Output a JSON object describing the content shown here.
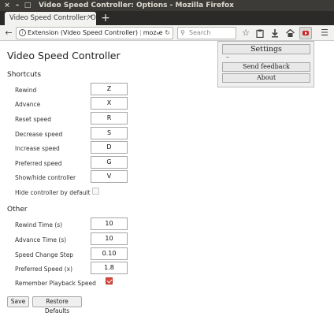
{
  "window": {
    "title": "Video Speed Controller: Options - Mozilla Firefox",
    "close_glyph": "×",
    "min_glyph": "–",
    "max_glyph": "□"
  },
  "tabs": [
    {
      "label": "Video Speed Controller: O",
      "close": "×"
    }
  ],
  "newtab_glyph": "+",
  "navbar": {
    "url_identity": "Extension (Video Speed Controller)",
    "url_text": "moz-e",
    "search_placeholder": "Search"
  },
  "page": {
    "title": "Video Speed Controller",
    "shortcuts_heading": "Shortcuts",
    "shortcuts": [
      {
        "label": "Rewind",
        "key": "Z"
      },
      {
        "label": "Advance",
        "key": "X"
      },
      {
        "label": "Reset speed",
        "key": "R"
      },
      {
        "label": "Decrease speed",
        "key": "S"
      },
      {
        "label": "Increase speed",
        "key": "D"
      },
      {
        "label": "Preferred speed",
        "key": "G"
      },
      {
        "label": "Show/hide controller",
        "key": "V"
      }
    ],
    "hide_controller_label": "Hide controller by default",
    "hide_controller_checked": false,
    "other_heading": "Other",
    "other": [
      {
        "label": "Rewind Time (s)",
        "value": "10"
      },
      {
        "label": "Advance Time (s)",
        "value": "10"
      },
      {
        "label": "Speed Change Step",
        "value": "0.10"
      },
      {
        "label": "Preferred Speed (x)",
        "value": "1.8"
      }
    ],
    "remember_label": "Remember Playback Speed",
    "remember_checked": true,
    "save_label": "Save",
    "restore_label": "Restore Defaults"
  },
  "popup": {
    "settings_label": "Settings",
    "feedback_label": "Send feedback",
    "about_label": "About"
  }
}
